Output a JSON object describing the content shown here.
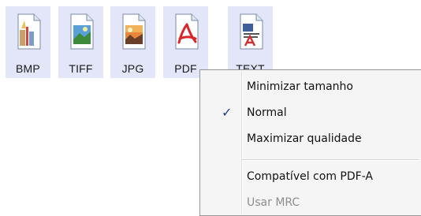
{
  "toolbar": {
    "buttons": [
      {
        "label": "BMP",
        "icon": "bmp-file-icon"
      },
      {
        "label": "TIFF",
        "icon": "tiff-file-icon"
      },
      {
        "label": "JPG",
        "icon": "jpg-file-icon"
      },
      {
        "label": "PDF",
        "icon": "pdf-file-icon"
      },
      {
        "label": "TEXT",
        "icon": "text-file-icon"
      }
    ]
  },
  "menu": {
    "items": [
      {
        "label": "Minimizar tamanho",
        "checked": false,
        "enabled": true
      },
      {
        "label": "Normal",
        "checked": true,
        "enabled": true
      },
      {
        "label": "Maximizar qualidade",
        "checked": false,
        "enabled": true
      },
      {
        "label": "Compatível com PDF-A",
        "checked": false,
        "enabled": true
      },
      {
        "label": "Usar MRC",
        "checked": false,
        "enabled": false
      }
    ],
    "check_glyph": "✓"
  },
  "colors": {
    "button_bg": "#e2e6f8",
    "menu_bg": "#f5f5f5",
    "check": "#1b3f8f",
    "disabled_text": "#8d8d8d"
  }
}
